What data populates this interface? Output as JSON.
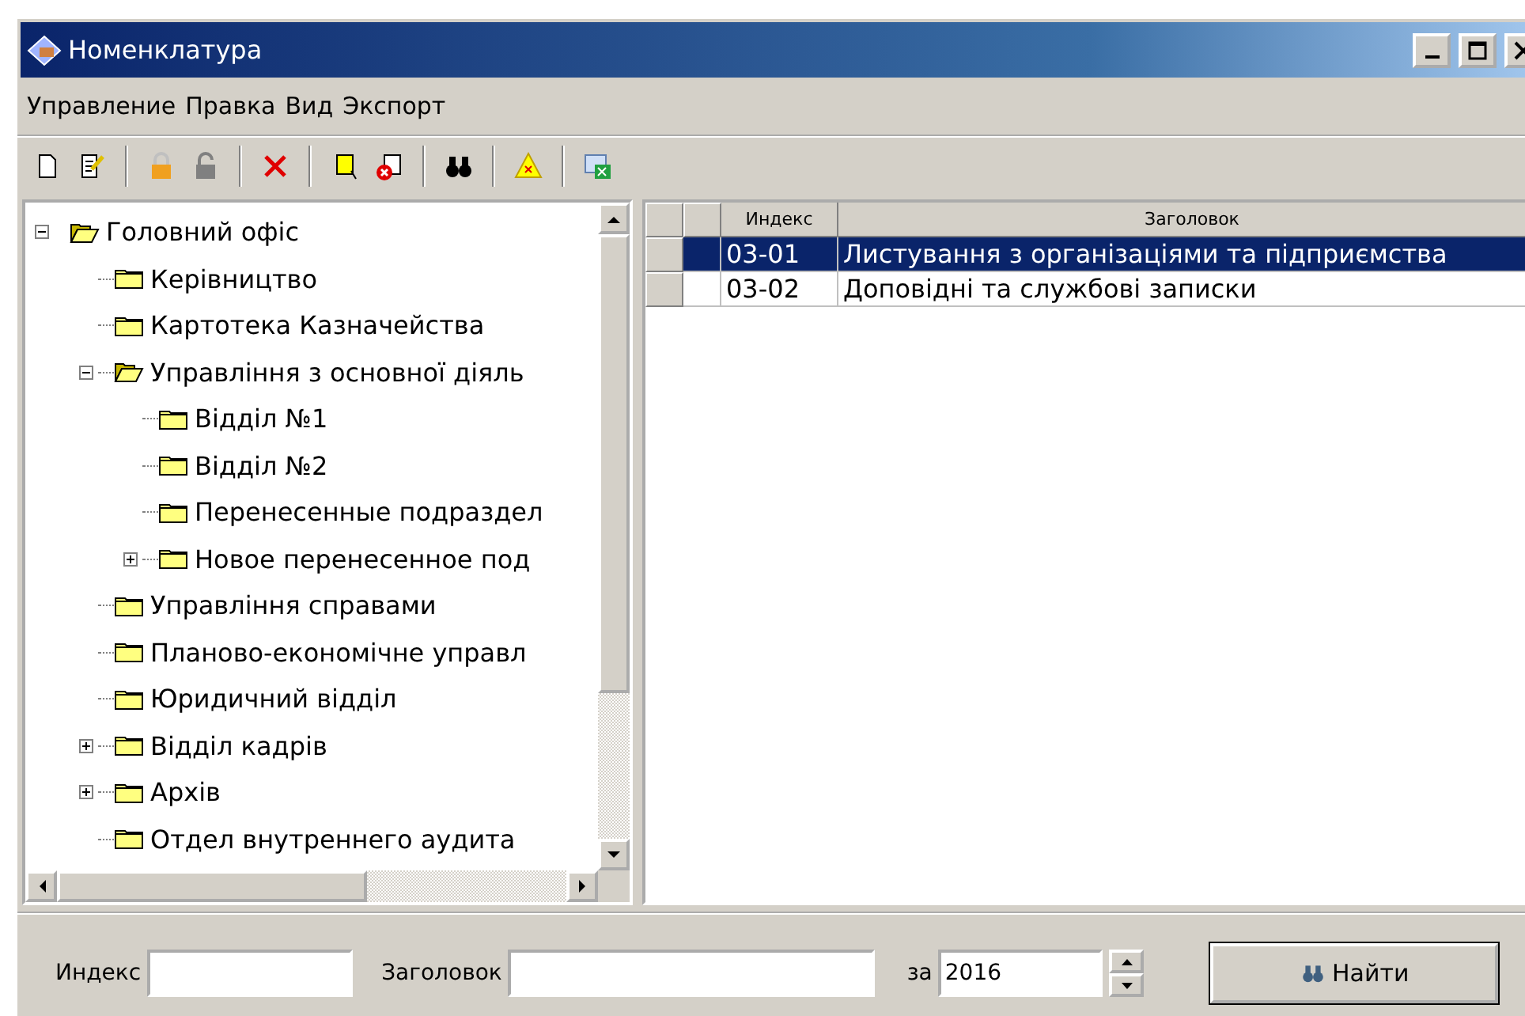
{
  "window": {
    "title": "Номенклатура"
  },
  "menu": [
    "Управление",
    "Правка",
    "Вид",
    "Экспорт"
  ],
  "tree": [
    {
      "label": "Головний офіс",
      "expanded": true,
      "children": [
        {
          "label": "Керівництво"
        },
        {
          "label": "Картотека Казначейства"
        },
        {
          "label": "Управління з основної діяль",
          "expanded": true,
          "children": [
            {
              "label": "Відділ №1"
            },
            {
              "label": "Відділ №2"
            },
            {
              "label": "Перенесенные подраздел"
            },
            {
              "label": "Новое перенесенное под",
              "expanded": false
            }
          ]
        },
        {
          "label": "Управління справами"
        },
        {
          "label": "Планово-економічне управл"
        },
        {
          "label": "Юридичний відділ"
        },
        {
          "label": "Відділ кадрів",
          "expanded": false
        },
        {
          "label": "Архів",
          "expanded": false
        },
        {
          "label": "Отдел внутреннего аудита"
        }
      ]
    }
  ],
  "table": {
    "columns": [
      "Индекс",
      "Заголовок"
    ],
    "rows": [
      {
        "index": "03-01",
        "title": "Листування з організаціями та підприємства",
        "selected": true
      },
      {
        "index": "03-02",
        "title": "Доповідні та службові записки",
        "selected": false
      }
    ]
  },
  "search": {
    "index_label": "Индекс",
    "title_label": "Заголовок",
    "year_label": "за",
    "year": "2016",
    "button": "Найти"
  }
}
